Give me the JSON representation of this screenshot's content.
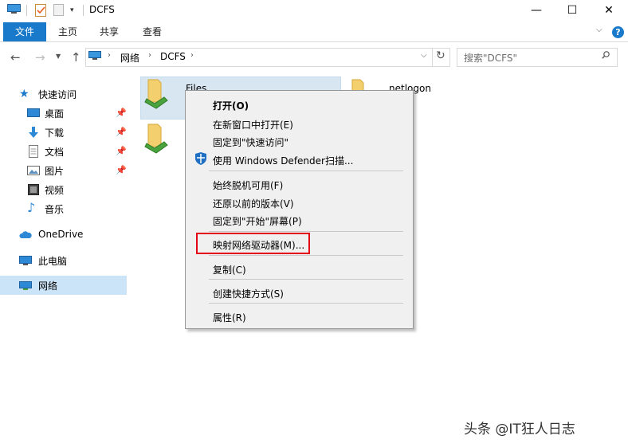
{
  "window": {
    "title": "DCFS",
    "min_glyph": "—",
    "max_glyph": "☐",
    "close_glyph": "✕"
  },
  "ribbon": {
    "tabs": [
      "文件",
      "主页",
      "共享",
      "查看"
    ],
    "file_tab_color": "#1979ca",
    "expand_glyph": "⌵",
    "help_glyph": "?"
  },
  "address": {
    "crumbs": [
      "网络",
      "DCFS"
    ],
    "separator": "›",
    "dropdown_glyph": "⌵",
    "refresh_glyph": "↻"
  },
  "search": {
    "placeholder": "搜索\"DCFS\""
  },
  "nav_pane": {
    "quick_access": "快速访问",
    "items": [
      {
        "label": "桌面",
        "icon": "desktop-icon",
        "pinned": true
      },
      {
        "label": "下载",
        "icon": "download-icon",
        "pinned": true
      },
      {
        "label": "文档",
        "icon": "document-icon",
        "pinned": true
      },
      {
        "label": "图片",
        "icon": "picture-icon",
        "pinned": true
      },
      {
        "label": "视频",
        "icon": "video-icon",
        "pinned": false
      },
      {
        "label": "音乐",
        "icon": "music-icon",
        "pinned": false
      }
    ],
    "onedrive": "OneDrive",
    "this_pc": "此电脑",
    "network": "网络",
    "selected_color": "#cce4f7"
  },
  "content": {
    "items": [
      {
        "name": "Files",
        "selected": true
      },
      {
        "name": "netlogon",
        "selected": false
      }
    ]
  },
  "context_menu": {
    "open": "打开(O)",
    "open_new_window": "在新窗口中打开(E)",
    "pin_quick_access": "固定到\"快速访问\"",
    "defender_scan": "使用 Windows Defender扫描...",
    "always_offline": "始终脱机可用(F)",
    "restore_previous": "还原以前的版本(V)",
    "pin_start": "固定到\"开始\"屏幕(P)",
    "map_drive": "映射网络驱动器(M)...",
    "copy": "复制(C)",
    "create_shortcut": "创建快捷方式(S)",
    "properties": "属性(R)",
    "highlight_color": "#e30012"
  },
  "watermark": "头条 @IT狂人日志"
}
